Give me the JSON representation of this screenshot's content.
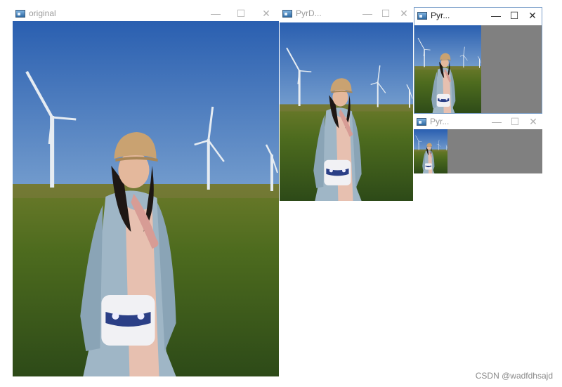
{
  "windows": {
    "original": {
      "title": "original",
      "active": false
    },
    "pyr1": {
      "title": "PyrD...",
      "active": false
    },
    "pyr2": {
      "title": "Pyr...",
      "active": true
    },
    "pyr3": {
      "title": "Pyr...",
      "active": false
    }
  },
  "controls": {
    "minimize": "—",
    "maximize": "☐",
    "close": "✕"
  },
  "watermark": "CSDN @wadfdhsajd",
  "icons": [
    "app-window-icon",
    "minimize-icon",
    "maximize-icon",
    "close-icon"
  ]
}
